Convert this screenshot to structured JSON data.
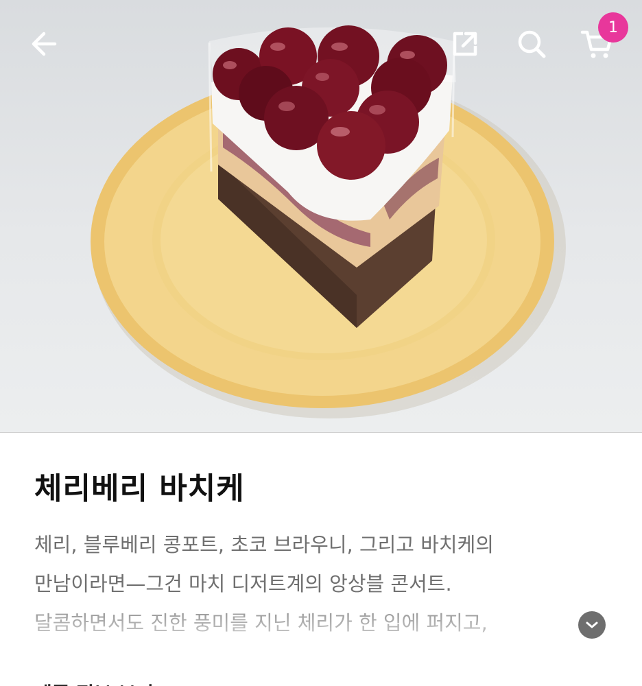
{
  "header": {
    "back_icon": "arrow-left-icon",
    "share_icon": "share-icon",
    "search_icon": "search-icon",
    "cart_icon": "cart-icon",
    "cart_count": "1",
    "badge_color": "#e8379b"
  },
  "product": {
    "title": "체리베리 바치케",
    "description_lines": [
      "체리, 블루베리 콩포트, 초코 브라우니, 그리고 바치케의",
      "만남이라면—그건 마치 디저트계의 앙상블 콘서트.",
      "달콤하면서도 진한 풍미를 지닌 체리가 한 입에 퍼지고,"
    ],
    "expand_icon": "chevron-down-icon"
  },
  "next_section": {
    "heading": "제품 정보 보기"
  },
  "colors": {
    "title": "#111111",
    "description": "#6f6f6f",
    "expand_button": "#6e6e6e"
  }
}
